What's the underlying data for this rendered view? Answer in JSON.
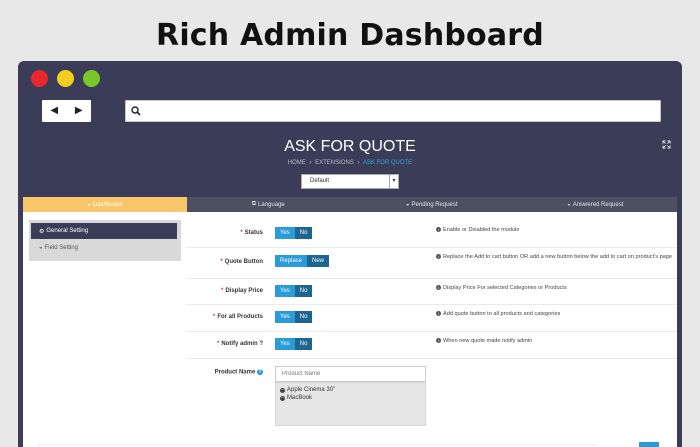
{
  "hero_title": "Rich Admin Dashboard",
  "browser": {
    "back_icon": "◀",
    "forward_icon": "▶",
    "url_value": ""
  },
  "page": {
    "title": "ASK FOR QUOTE",
    "breadcrumb": {
      "home": "HOME",
      "extensions": "EXTENSIONS",
      "current": "ASK FOR QUOTE",
      "separator": "›"
    },
    "language_select": "Default",
    "caret": "▾"
  },
  "tabs": [
    {
      "label": "Dashboard",
      "icon": "dashboard-icon",
      "glyph": "◒"
    },
    {
      "label": "Language",
      "icon": "language-icon",
      "glyph": "⧉"
    },
    {
      "label": "Pending Request",
      "icon": "pending-icon",
      "glyph": "◒"
    },
    {
      "label": "Answered Request",
      "icon": "answered-icon",
      "glyph": "◒"
    }
  ],
  "sidebar": {
    "items": [
      {
        "label": "General Setting",
        "glyph": "⚙"
      },
      {
        "label": "Field Setting",
        "glyph": "◒"
      }
    ]
  },
  "form": {
    "required_mark": "*",
    "info_glyph": "i",
    "status": {
      "label": "Status",
      "on": "Yes",
      "off": "No",
      "help": "Enable or Disabled the module"
    },
    "quote_button": {
      "label": "Quote Button",
      "on": "Replace",
      "off": "New",
      "help": "Replace the Add to cart button OR add a new button below the add to cart on product's page"
    },
    "display_price": {
      "label": "Display Price",
      "on": "Yes",
      "off": "No",
      "help": "Display Price For selected Categories or Products"
    },
    "for_all_products": {
      "label": "For all Products",
      "on": "Yes",
      "off": "No",
      "help": "Add quote button to all products and categories"
    },
    "notify_admin": {
      "label": "Notify admin ?",
      "on": "Yes",
      "off": "No",
      "help": "When new quote made notify admin"
    },
    "product_name": {
      "label": "Product Name",
      "help_glyph": "?",
      "placeholder": "Product Name",
      "remove_glyph": "−",
      "items": [
        "Apple Cinema 30\"",
        "MacBook"
      ]
    }
  },
  "colors": {
    "chrome": "#3a3c58",
    "accent_tab": "#f7c56a",
    "toggle_on": "#2a9ad8",
    "toggle_off": "#1e668f",
    "required": "#d03c3c"
  }
}
